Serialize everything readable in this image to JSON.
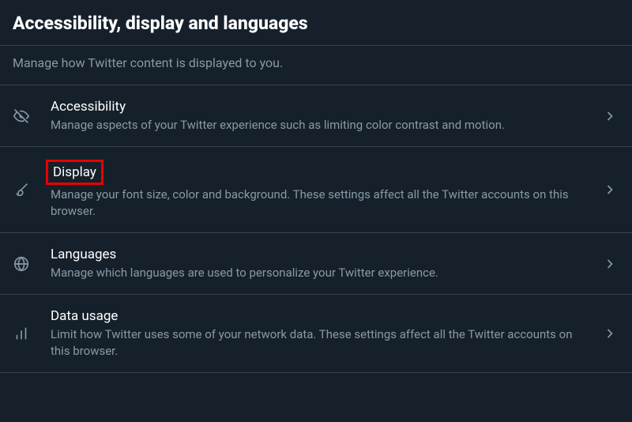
{
  "header": {
    "title": "Accessibility, display and languages"
  },
  "subtitle": "Manage how Twitter content is displayed to you.",
  "items": [
    {
      "title": "Accessibility",
      "desc": "Manage aspects of your Twitter experience such as limiting color contrast and motion."
    },
    {
      "title": "Display",
      "desc": "Manage your font size, color and background. These settings affect all the Twitter accounts on this browser."
    },
    {
      "title": "Languages",
      "desc": "Manage which languages are used to personalize your Twitter experience."
    },
    {
      "title": "Data usage",
      "desc": "Limit how Twitter uses some of your network data. These settings affect all the Twitter accounts on this browser."
    }
  ]
}
